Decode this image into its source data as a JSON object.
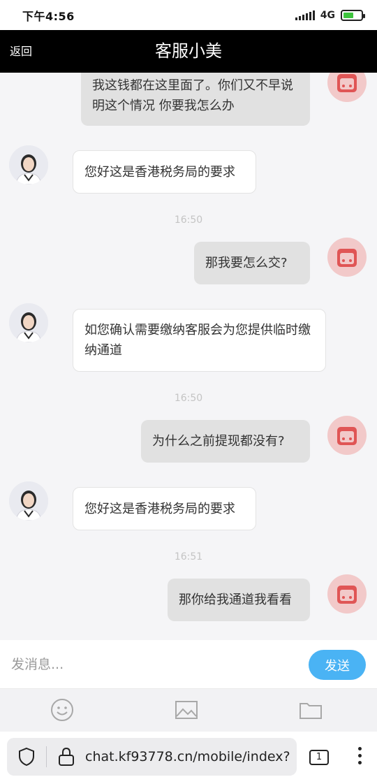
{
  "status_bar": {
    "time": "下午4:56",
    "network": "4G"
  },
  "header": {
    "back_label": "返回",
    "title": "客服小美"
  },
  "chat": {
    "messages": [
      {
        "role": "user",
        "text": "我这钱都在这里面了。你们又不早说明这个情况 你要我怎么办"
      },
      {
        "role": "agent",
        "text": "您好这是香港税务局的要求"
      },
      {
        "role": "timestamp",
        "text": "16:50"
      },
      {
        "role": "user",
        "text": "那我要怎么交?"
      },
      {
        "role": "agent",
        "text": "如您确认需要缴纳客服会为您提供临时缴纳通道"
      },
      {
        "role": "timestamp",
        "text": "16:50"
      },
      {
        "role": "user",
        "text": "为什么之前提现都没有?"
      },
      {
        "role": "agent",
        "text": "您好这是香港税务局的要求"
      },
      {
        "role": "timestamp",
        "text": "16:51"
      },
      {
        "role": "user",
        "text": "那你给我通道我看看"
      }
    ]
  },
  "input_bar": {
    "placeholder": "发消息...",
    "send_label": "发送"
  },
  "toolbar": {
    "icons": [
      "emoji-icon",
      "image-icon",
      "folder-icon"
    ]
  },
  "browser": {
    "url": "chat.kf93778.cn/mobile/index?",
    "tab_count": "1"
  },
  "colors": {
    "header_bg": "#000000",
    "send_button": "#4ab3f4",
    "user_bubble": "#e1e1e1",
    "agent_bubble": "#ffffff",
    "user_avatar": "#e05555"
  }
}
